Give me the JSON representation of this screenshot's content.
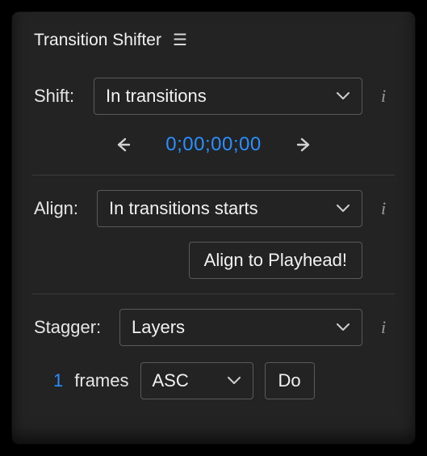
{
  "title": "Transition Shifter",
  "info_glyph": "i",
  "shift": {
    "label": "Shift:",
    "select": "In transitions",
    "timecode": "0;00;00;00"
  },
  "align": {
    "label": "Align:",
    "select": "In transitions starts",
    "button": "Align to Playhead!"
  },
  "stagger": {
    "label": "Stagger:",
    "select": "Layers",
    "count": "1",
    "units": "frames",
    "order": "ASC",
    "go": "Do"
  }
}
